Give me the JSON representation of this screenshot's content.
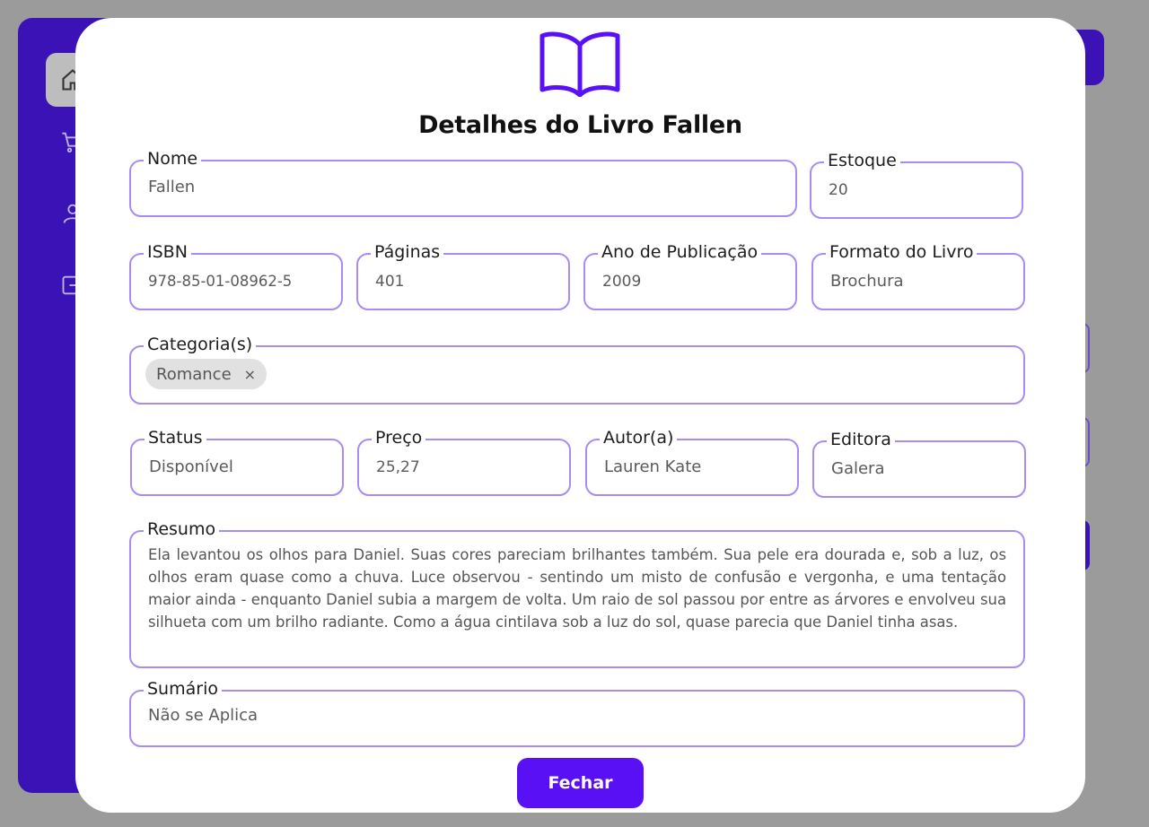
{
  "modal": {
    "title": "Detalhes do Livro Fallen",
    "close_label": "Fechar"
  },
  "fields": {
    "nome": {
      "label": "Nome",
      "value": "Fallen"
    },
    "estoque": {
      "label": "Estoque",
      "value": "20"
    },
    "isbn": {
      "label": "ISBN",
      "value": "978-85-01-08962-5"
    },
    "paginas": {
      "label": "Páginas",
      "value": "401"
    },
    "ano": {
      "label": "Ano de Publicação",
      "value": "2009"
    },
    "formato": {
      "label": "Formato do Livro",
      "value": "Brochura"
    },
    "categorias": {
      "label": "Categoria(s)",
      "chips": [
        "Romance"
      ],
      "chip_remove": "×"
    },
    "status": {
      "label": "Status",
      "value": "Disponível"
    },
    "preco": {
      "label": "Preço",
      "value": "25,27"
    },
    "autor": {
      "label": "Autor(a)",
      "value": "Lauren Kate"
    },
    "editora": {
      "label": "Editora",
      "value": "Galera"
    },
    "resumo": {
      "label": "Resumo",
      "value": "Ela levantou os olhos para Daniel. Suas cores pareciam brilhantes também. Sua pele era dourada e, sob a luz, os olhos eram quase como a chuva. Luce observou - sentindo um misto de confusão e vergonha, e uma tentação maior ainda - enquanto Daniel subia a margem de volta. Um raio de sol passou por entre as árvores e envolveu sua silhueta com um brilho radiante. Como a água cintilava sob a luz do sol, quase parecia que Daniel tinha asas."
    },
    "sumario": {
      "label": "Sumário",
      "value": "Não se Aplica"
    }
  },
  "background": {
    "sidebar_icons": [
      "home-icon",
      "cart-icon",
      "user-icon",
      "logout-icon"
    ]
  },
  "colors": {
    "accent": "#5a10f5",
    "sidebar": "#3a12b5",
    "field_border": "#a98bf2",
    "overlay": "#9b9b9b"
  }
}
